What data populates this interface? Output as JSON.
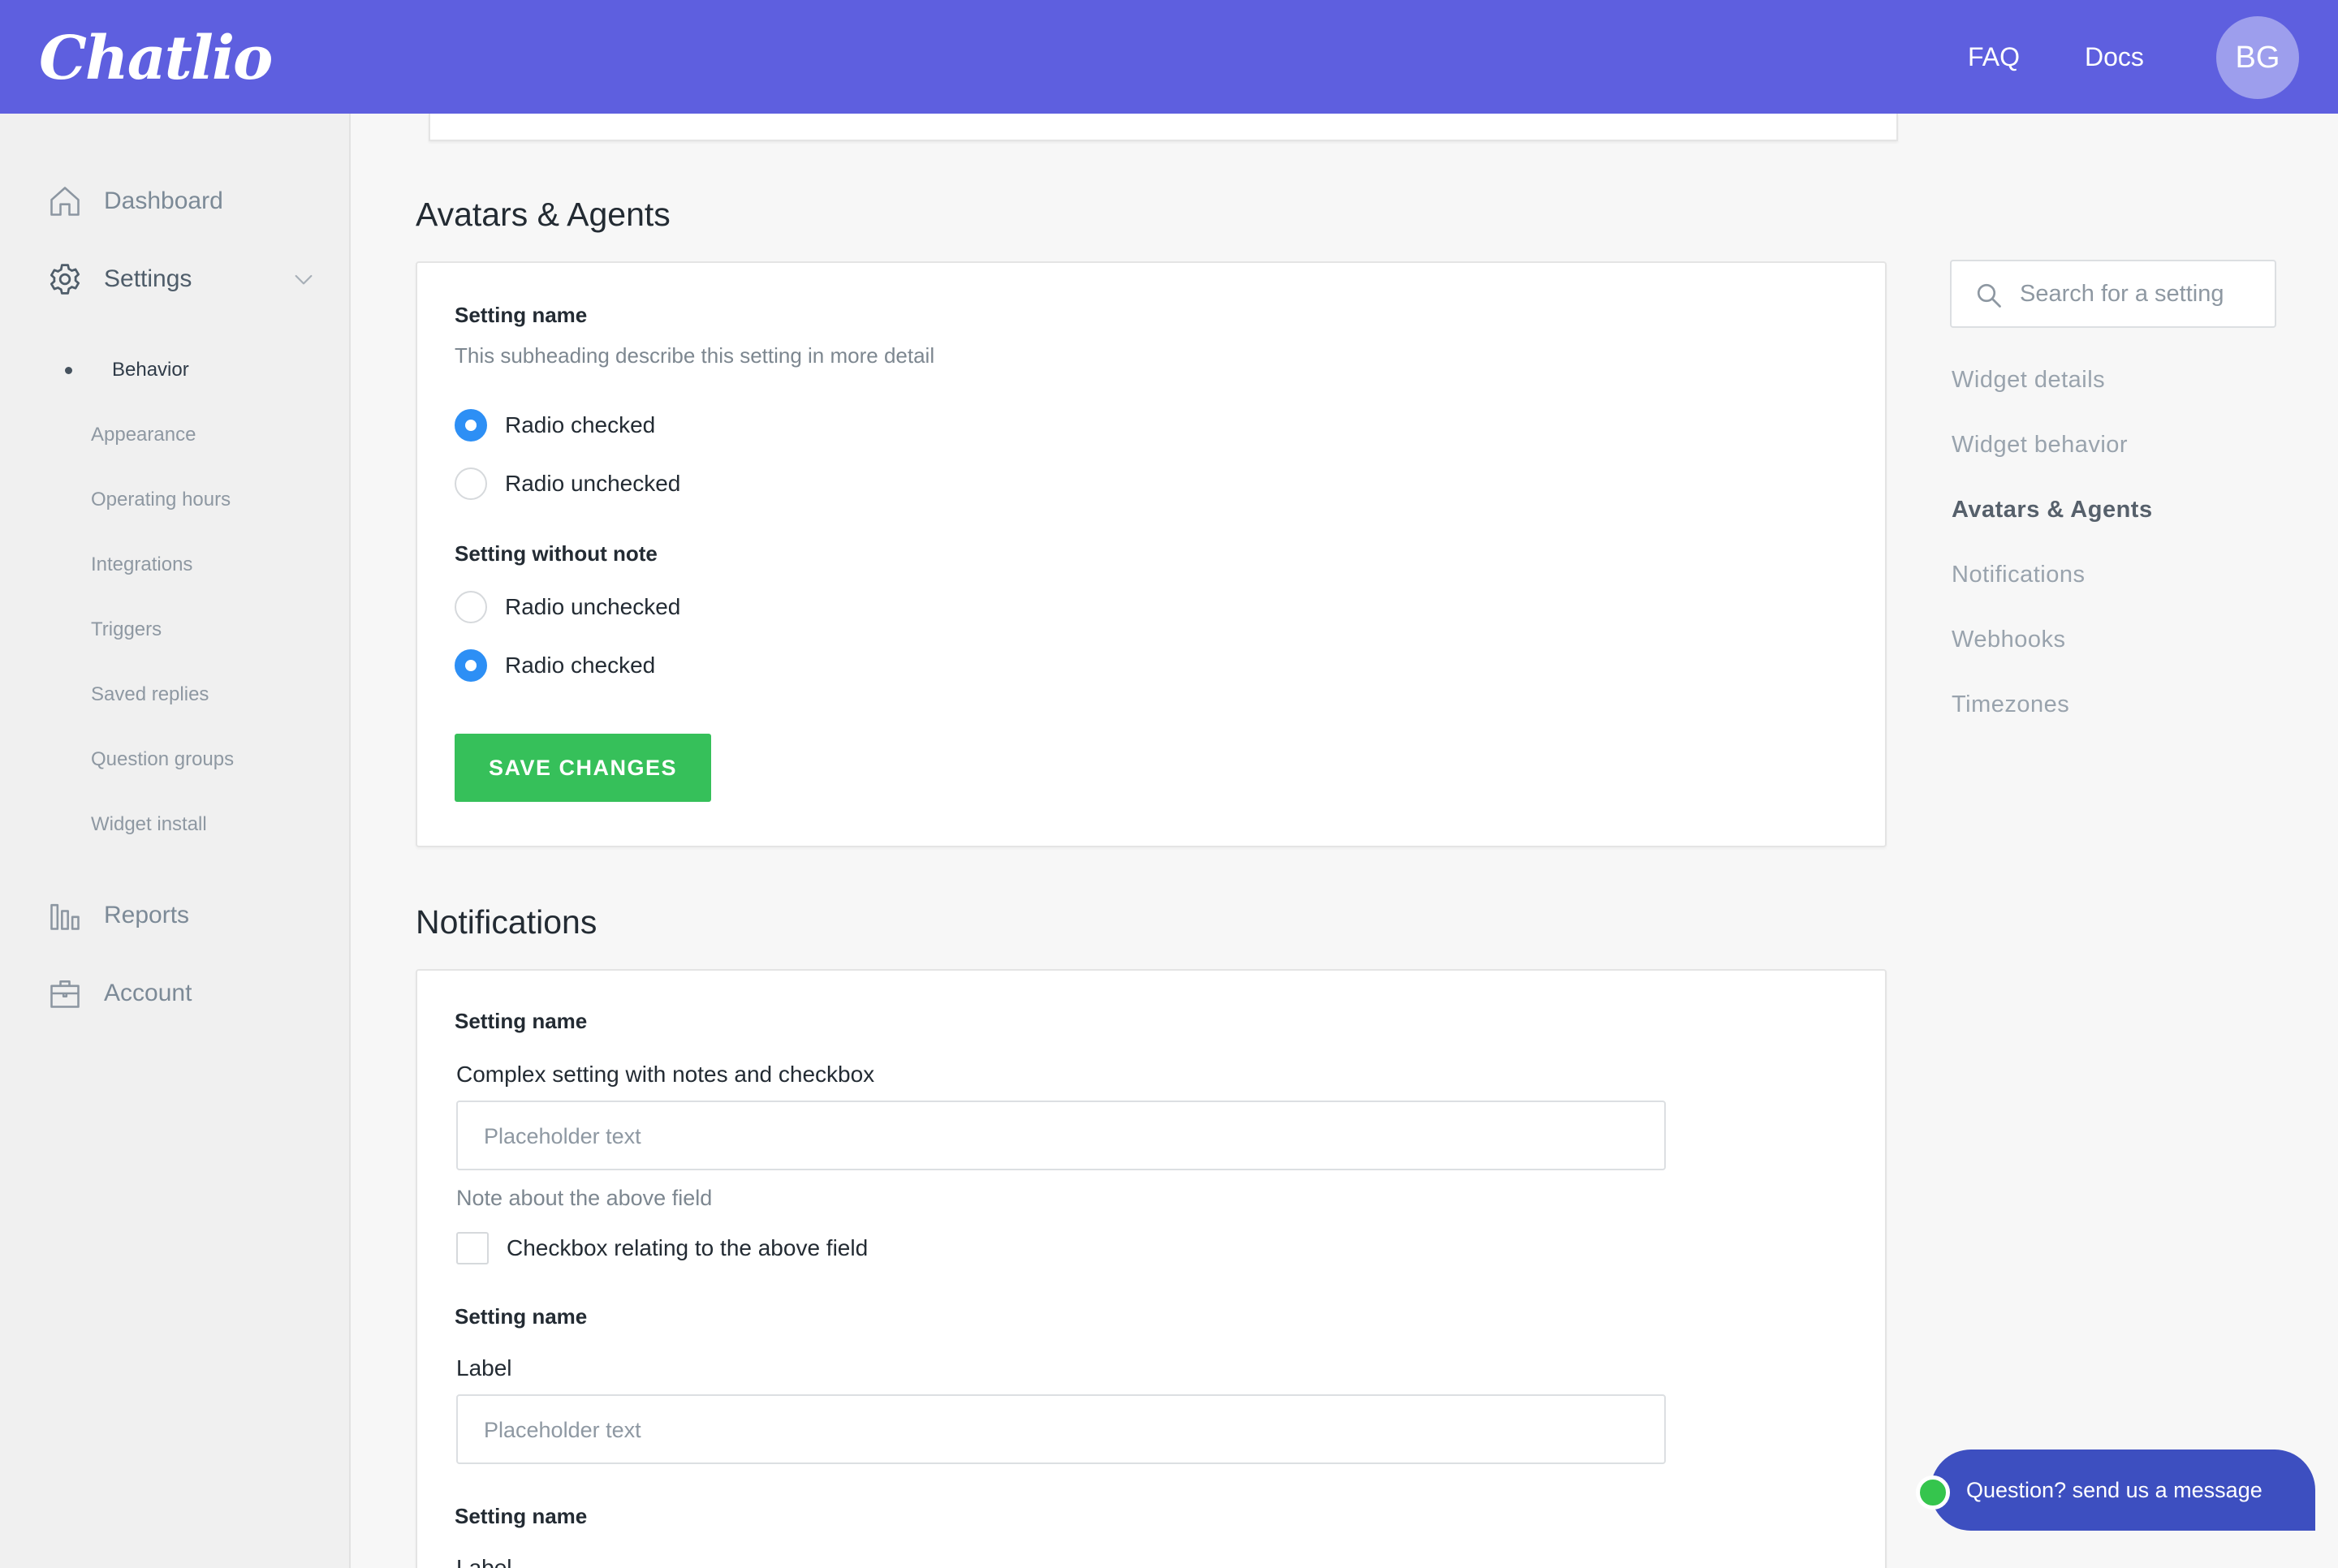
{
  "header": {
    "logo": "Chatlio",
    "faq": "FAQ",
    "docs": "Docs",
    "avatar_initials": "BG",
    "bar_color": "#5e5fdf"
  },
  "sidebar": {
    "dashboard": {
      "label": "Dashboard",
      "icon": "home-icon"
    },
    "settings": {
      "label": "Settings",
      "icon": "gear-icon"
    },
    "settings_sub": [
      {
        "label": "Behavior",
        "active": true
      },
      {
        "label": "Appearance"
      },
      {
        "label": "Operating hours"
      },
      {
        "label": "Integrations"
      },
      {
        "label": "Triggers"
      },
      {
        "label": "Saved replies"
      },
      {
        "label": "Question groups"
      },
      {
        "label": "Widget install"
      }
    ],
    "reports": {
      "label": "Reports",
      "icon": "bar-chart-icon"
    },
    "account": {
      "label": "Account",
      "icon": "briefcase-icon"
    }
  },
  "avatars_section": {
    "title": "Avatars & Agents",
    "setting1": {
      "name": "Setting name",
      "subheading": "This subheading describe this setting in more detail",
      "options": [
        {
          "label": "Radio checked",
          "checked": true
        },
        {
          "label": "Radio unchecked",
          "checked": false
        }
      ]
    },
    "setting2": {
      "name": "Setting without note",
      "options": [
        {
          "label": "Radio unchecked",
          "checked": false
        },
        {
          "label": "Radio checked",
          "checked": true
        }
      ]
    },
    "save_label": "SAVE CHANGES",
    "save_color": "#36c05a"
  },
  "notifications_section": {
    "title": "Notifications",
    "setting1": {
      "name": "Setting name",
      "field_label": "Complex setting with notes and checkbox",
      "placeholder": "Placeholder text",
      "note": "Note about the above field",
      "checkbox_label": "Checkbox relating to the above field",
      "checkbox_checked": false
    },
    "setting2": {
      "name": "Setting name",
      "field_label": "Label",
      "placeholder": "Placeholder text"
    },
    "setting3": {
      "name": "Setting name",
      "field_label": "Label"
    }
  },
  "right_rail": {
    "search_placeholder": "Search for a setting",
    "toc": [
      {
        "label": "Widget details"
      },
      {
        "label": "Widget behavior"
      },
      {
        "label": "Avatars & Agents",
        "active": true
      },
      {
        "label": "Notifications"
      },
      {
        "label": "Webhooks"
      },
      {
        "label": "Timezones"
      }
    ]
  },
  "chat_widget": {
    "label": "Question? send us a message",
    "online_color": "#35c54d"
  }
}
